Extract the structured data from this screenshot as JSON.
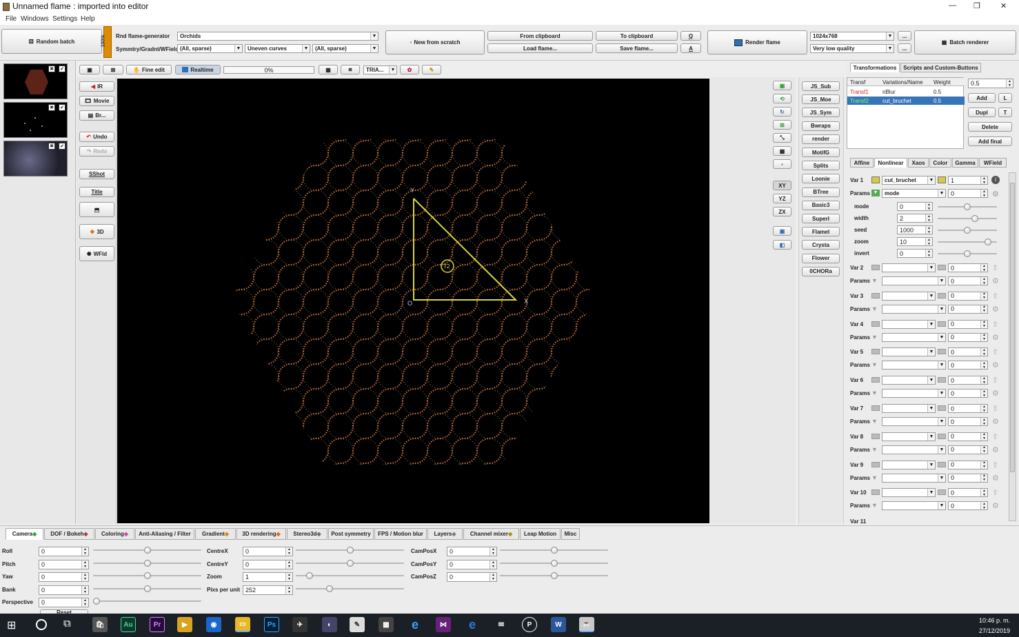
{
  "window": {
    "title": "Unnamed flame : imported into editor",
    "minimize": "—",
    "maximize": "❐",
    "close": "✕"
  },
  "menu": [
    "File",
    "Windows",
    "Settings",
    "Help"
  ],
  "toolbar": {
    "random_batch": "Random batch",
    "percent_bar": "100%",
    "rnd_gen_label": "Rnd flame-generator",
    "rnd_gen_value": "Orchids",
    "symmetry_label": "Symmtry/Gradnt/WField",
    "sym1": "(All, sparse)",
    "sym2": "Uneven curves",
    "sym3": "(All, sparse)",
    "new_scratch": "New from scratch",
    "from_clipboard": "From clipboard",
    "load_flame": "Load flame...",
    "to_clipboard": "To clipboard",
    "save_flame": "Save flame...",
    "q_btn": "Q",
    "a_btn": "A",
    "render_flame": "Render flame",
    "resolution": "1024x768",
    "quality": "Very low quality",
    "dots": "...",
    "batch_renderer": "Batch renderer"
  },
  "editor_toolbar": {
    "fine_edit": "Fine edit",
    "realtime": "Realtime",
    "progress": "0%",
    "tria": "TRIA..."
  },
  "left_tools": {
    "ir": "IR",
    "movie": "Movie",
    "br": "Br...",
    "undo": "Undo",
    "redo": "Redo",
    "sshot": "SShot",
    "title": "Title",
    "threed": "3D",
    "wfld": "WFld"
  },
  "view_buttons": [
    "XY",
    "YZ",
    "ZX"
  ],
  "script_buttons": [
    "JS_Sub",
    "JS_Moe",
    "JS_Sym",
    "Bwraps",
    "render",
    "MotifG",
    "Splits",
    "Loonie",
    "BTree",
    "Basic3",
    "SuperI",
    "Flamel",
    "Crysta",
    "Flower",
    "0CHORa"
  ],
  "triangle": {
    "label": "T2",
    "y": "Y",
    "x": "X",
    "o": "O"
  },
  "right_tabs": [
    "Transformations",
    "Scripts and Custom-Buttons"
  ],
  "transform_table": {
    "headers": [
      "Transf",
      "Variations/Name",
      "Weight"
    ],
    "rows": [
      {
        "name": "Transf1",
        "var": "nBlur",
        "weight": "0.5"
      },
      {
        "name": "Transf2",
        "var": "cut_bruchet",
        "weight": "0.5"
      }
    ]
  },
  "transform_side": {
    "weight_value": "0.5",
    "add": "Add",
    "l": "L",
    "dupl": "Dupl",
    "t": "T",
    "delete": "Delete",
    "add_final": "Add final"
  },
  "sub_tabs": [
    "Affine",
    "Nonlinear",
    "Xaos",
    "Color",
    "Gamma",
    "WField"
  ],
  "var1": {
    "label": "Var 1",
    "value": "cut_bruchet",
    "amount": "1",
    "params_label": "Params",
    "param_sel": "mode",
    "params": [
      {
        "name": "mode",
        "value": "0",
        "pos": 0.5
      },
      {
        "name": "width",
        "value": "2",
        "pos": 0.65
      },
      {
        "name": "seed",
        "value": "1000",
        "pos": 0.5
      },
      {
        "name": "zoom",
        "value": "10",
        "pos": 0.9
      },
      {
        "name": "invert",
        "value": "0",
        "pos": 0.5
      }
    ]
  },
  "vars": [
    {
      "label": "Var 2",
      "value": "0"
    },
    {
      "label": "Var 3",
      "value": "0"
    },
    {
      "label": "Var 4",
      "value": "0"
    },
    {
      "label": "Var 5",
      "value": "0"
    },
    {
      "label": "Var 6",
      "value": "0"
    },
    {
      "label": "Var 7",
      "value": "0"
    },
    {
      "label": "Var 8",
      "value": "0"
    },
    {
      "label": "Var 9",
      "value": "0"
    },
    {
      "label": "Var 10",
      "value": "0"
    }
  ],
  "params_label": "Params",
  "params_value": "0",
  "var11": "Var 11",
  "bottom_tabs": [
    "Camera",
    "DOF / Bokeh",
    "Coloring",
    "Anti-Aliasing / Filter",
    "Gradient",
    "3D rendering",
    "Stereo3d",
    "Post symmetry",
    "FPS / Motion blur",
    "Layers",
    "Channel mixer",
    "Leap Motion",
    "Misc"
  ],
  "camera": {
    "col1": [
      {
        "label": "Roll",
        "value": "0",
        "pos": 0.5
      },
      {
        "label": "Pitch",
        "value": "0",
        "pos": 0.5
      },
      {
        "label": "Yaw",
        "value": "0",
        "pos": 0.5
      },
      {
        "label": "Bank",
        "value": "0",
        "pos": 0.5
      },
      {
        "label": "Perspective",
        "value": "0",
        "pos": 0.0
      }
    ],
    "col2": [
      {
        "label": "CentreX",
        "value": "0",
        "pos": 0.5
      },
      {
        "label": "CentreY",
        "value": "0",
        "pos": 0.5
      },
      {
        "label": "Zoom",
        "value": "1",
        "pos": 0.1
      },
      {
        "label": "Pixs per unit",
        "value": "252",
        "pos": 0.3
      }
    ],
    "col3": [
      {
        "label": "CamPosX",
        "value": "0",
        "pos": 0.5
      },
      {
        "label": "CamPosY",
        "value": "0",
        "pos": 0.5
      },
      {
        "label": "CamPosZ",
        "value": "0",
        "pos": 0.5
      }
    ],
    "reset": "Reset"
  },
  "taskbar": {
    "time": "10:46 p. m.",
    "date": "27/12/2019"
  },
  "colors": {
    "accent": "#2f6fb5",
    "selected_row": "#3875b8",
    "triangle": "#d8d83a",
    "percent": "#e08a00"
  }
}
